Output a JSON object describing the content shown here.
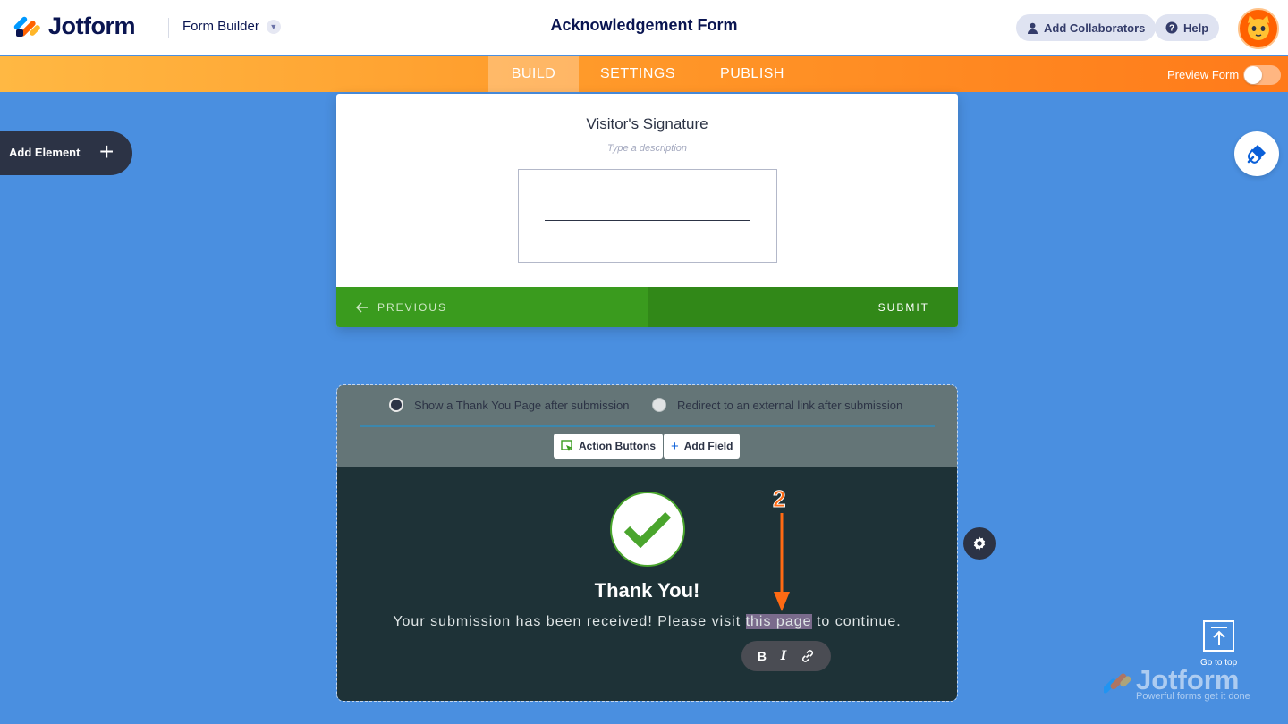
{
  "header": {
    "brand": "Jotform",
    "builder_label": "Form Builder",
    "form_title": "Acknowledgement Form",
    "add_collaborators": "Add Collaborators",
    "help": "Help"
  },
  "nav": {
    "tabs": [
      {
        "label": "BUILD",
        "active": true
      },
      {
        "label": "SETTINGS",
        "active": false
      },
      {
        "label": "PUBLISH",
        "active": false
      }
    ],
    "preview_label": "Preview Form",
    "preview_enabled": false
  },
  "sidebar": {
    "add_element": "Add Element"
  },
  "signature_field": {
    "label": "Visitor's Signature",
    "description_placeholder": "Type a description"
  },
  "form_nav": {
    "previous": "PREVIOUS",
    "submit": "SUBMIT"
  },
  "thank_you": {
    "options": [
      {
        "label": "Show a Thank You Page after submission",
        "selected": true
      },
      {
        "label": "Redirect to an external link after submission",
        "selected": false
      }
    ],
    "action_buttons": "Action Buttons",
    "add_field": "Add Field",
    "title": "Thank You!",
    "message_before": "Your submission has been received! Please visit ",
    "message_link": "this page",
    "message_after": " to continue.",
    "format_buttons": [
      "B",
      "I"
    ]
  },
  "annotation": {
    "step": "2"
  },
  "footer": {
    "go_to_top": "Go to top",
    "watermark_brand": "Jotform",
    "watermark_tagline": "Powerful forms get it done"
  },
  "colors": {
    "canvas": "#4a8fe0",
    "brand_navy": "#0a1551",
    "nav_orange": "#ff7a1a",
    "submit_green": "#318818",
    "thankyou_bg": "#1e3237",
    "annotation_orange": "#ff6a13"
  },
  "icons": [
    "jotform-logo-icon",
    "chevron-down-icon",
    "user-icon",
    "help-icon",
    "plus-icon",
    "paint-brush-icon",
    "arrow-left-icon",
    "action-cursor-icon",
    "plus-small-icon",
    "checkmark-icon",
    "link-icon",
    "gear-icon",
    "arrow-up-to-line-icon"
  ]
}
